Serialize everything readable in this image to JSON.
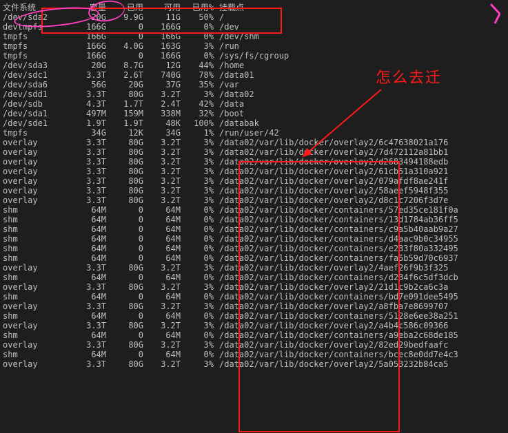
{
  "header": {
    "fs": "文件系统",
    "size": "容量",
    "used": "已用",
    "avail": "可用",
    "pct": "已用%",
    "mnt": "挂载点"
  },
  "rows": [
    {
      "fs": "/dev/sda2",
      "size": "20G",
      "used": "9.9G",
      "avail": "11G",
      "pct": "50%",
      "mnt": "/"
    },
    {
      "fs": "devtmpfs",
      "size": "166G",
      "used": "0",
      "avail": "166G",
      "pct": "0%",
      "mnt": "/dev"
    },
    {
      "fs": "tmpfs",
      "size": "166G",
      "used": "0",
      "avail": "166G",
      "pct": "0%",
      "mnt": "/dev/shm"
    },
    {
      "fs": "tmpfs",
      "size": "166G",
      "used": "4.0G",
      "avail": "163G",
      "pct": "3%",
      "mnt": "/run"
    },
    {
      "fs": "tmpfs",
      "size": "166G",
      "used": "0",
      "avail": "166G",
      "pct": "0%",
      "mnt": "/sys/fs/cgroup"
    },
    {
      "fs": "/dev/sda3",
      "size": "20G",
      "used": "8.7G",
      "avail": "12G",
      "pct": "44%",
      "mnt": "/home"
    },
    {
      "fs": "/dev/sdc1",
      "size": "3.3T",
      "used": "2.6T",
      "avail": "740G",
      "pct": "78%",
      "mnt": "/data01"
    },
    {
      "fs": "/dev/sda6",
      "size": "56G",
      "used": "20G",
      "avail": "37G",
      "pct": "35%",
      "mnt": "/var"
    },
    {
      "fs": "/dev/sdd1",
      "size": "3.3T",
      "used": "80G",
      "avail": "3.2T",
      "pct": "3%",
      "mnt": "/data02"
    },
    {
      "fs": "/dev/sdb",
      "size": "4.3T",
      "used": "1.7T",
      "avail": "2.4T",
      "pct": "42%",
      "mnt": "/data"
    },
    {
      "fs": "/dev/sda1",
      "size": "497M",
      "used": "159M",
      "avail": "338M",
      "pct": "32%",
      "mnt": "/boot"
    },
    {
      "fs": "/dev/sde1",
      "size": "1.9T",
      "used": "1.9T",
      "avail": "48K",
      "pct": "100%",
      "mnt": "/databak"
    },
    {
      "fs": "tmpfs",
      "size": "34G",
      "used": "12K",
      "avail": "34G",
      "pct": "1%",
      "mnt": "/run/user/42"
    },
    {
      "fs": "overlay",
      "size": "3.3T",
      "used": "80G",
      "avail": "3.2T",
      "pct": "3%",
      "mnt": "/data02/var/lib/docker/overlay2/6c47638021a176"
    },
    {
      "fs": "overlay",
      "size": "3.3T",
      "used": "80G",
      "avail": "3.2T",
      "pct": "3%",
      "mnt": "/data02/var/lib/docker/overlay2/7d472112a81bb1"
    },
    {
      "fs": "overlay",
      "size": "3.3T",
      "used": "80G",
      "avail": "3.2T",
      "pct": "3%",
      "mnt": "/data02/var/lib/docker/overlay2/d2683494188edb"
    },
    {
      "fs": "overlay",
      "size": "3.3T",
      "used": "80G",
      "avail": "3.2T",
      "pct": "3%",
      "mnt": "/data02/var/lib/docker/overlay2/61cb51a310a921"
    },
    {
      "fs": "overlay",
      "size": "3.3T",
      "used": "80G",
      "avail": "3.2T",
      "pct": "3%",
      "mnt": "/data02/var/lib/docker/overlay2/079afdf8ae241f"
    },
    {
      "fs": "overlay",
      "size": "3.3T",
      "used": "80G",
      "avail": "3.2T",
      "pct": "3%",
      "mnt": "/data02/var/lib/docker/overlay2/58aeef5948f355"
    },
    {
      "fs": "overlay",
      "size": "3.3T",
      "used": "80G",
      "avail": "3.2T",
      "pct": "3%",
      "mnt": "/data02/var/lib/docker/overlay2/d8c1c7206f3d7e"
    },
    {
      "fs": "shm",
      "size": "64M",
      "used": "0",
      "avail": "64M",
      "pct": "0%",
      "mnt": "/data02/var/lib/docker/containers/57ed35ce181f0a"
    },
    {
      "fs": "shm",
      "size": "64M",
      "used": "0",
      "avail": "64M",
      "pct": "0%",
      "mnt": "/data02/var/lib/docker/containers/13d1784ab36ff5"
    },
    {
      "fs": "shm",
      "size": "64M",
      "used": "0",
      "avail": "64M",
      "pct": "0%",
      "mnt": "/data02/var/lib/docker/containers/c9a5b40aab9a27"
    },
    {
      "fs": "shm",
      "size": "64M",
      "used": "0",
      "avail": "64M",
      "pct": "0%",
      "mnt": "/data02/var/lib/docker/containers/d4aac9b0c34955"
    },
    {
      "fs": "shm",
      "size": "64M",
      "used": "0",
      "avail": "64M",
      "pct": "0%",
      "mnt": "/data02/var/lib/docker/containers/e233f80a332495"
    },
    {
      "fs": "shm",
      "size": "64M",
      "used": "0",
      "avail": "64M",
      "pct": "0%",
      "mnt": "/data02/var/lib/docker/containers/fa5b59d70c6937"
    },
    {
      "fs": "overlay",
      "size": "3.3T",
      "used": "80G",
      "avail": "3.2T",
      "pct": "3%",
      "mnt": "/data02/var/lib/docker/overlay2/4aef26f9b3f325"
    },
    {
      "fs": "shm",
      "size": "64M",
      "used": "0",
      "avail": "64M",
      "pct": "0%",
      "mnt": "/data02/var/lib/docker/containers/d234f6c5df3dcb"
    },
    {
      "fs": "overlay",
      "size": "3.3T",
      "used": "80G",
      "avail": "3.2T",
      "pct": "3%",
      "mnt": "/data02/var/lib/docker/overlay2/21d1c9b2ca6c3a"
    },
    {
      "fs": "shm",
      "size": "64M",
      "used": "0",
      "avail": "64M",
      "pct": "0%",
      "mnt": "/data02/var/lib/docker/containers/bd7e091dee5495"
    },
    {
      "fs": "overlay",
      "size": "3.3T",
      "used": "80G",
      "avail": "3.2T",
      "pct": "3%",
      "mnt": "/data02/var/lib/docker/overlay2/a8fba7e8699707"
    },
    {
      "fs": "shm",
      "size": "64M",
      "used": "0",
      "avail": "64M",
      "pct": "0%",
      "mnt": "/data02/var/lib/docker/containers/5128e6ee38a251"
    },
    {
      "fs": "overlay",
      "size": "3.3T",
      "used": "80G",
      "avail": "3.2T",
      "pct": "3%",
      "mnt": "/data02/var/lib/docker/overlay2/a4b4c586c09366"
    },
    {
      "fs": "shm",
      "size": "64M",
      "used": "0",
      "avail": "64M",
      "pct": "0%",
      "mnt": "/data02/var/lib/docker/containers/a9eba2c68de185"
    },
    {
      "fs": "overlay",
      "size": "3.3T",
      "used": "80G",
      "avail": "3.2T",
      "pct": "3%",
      "mnt": "/data02/var/lib/docker/overlay2/82ed29bedfaafc"
    },
    {
      "fs": "shm",
      "size": "64M",
      "used": "0",
      "avail": "64M",
      "pct": "0%",
      "mnt": "/data02/var/lib/docker/containers/bcec8e0dd7e4c3"
    },
    {
      "fs": "overlay",
      "size": "3.3T",
      "used": "80G",
      "avail": "3.2T",
      "pct": "3%",
      "mnt": "/data02/var/lib/docker/overlay2/5a053232b84ca5"
    }
  ],
  "annotations": {
    "red_text": "怎么去迁"
  }
}
